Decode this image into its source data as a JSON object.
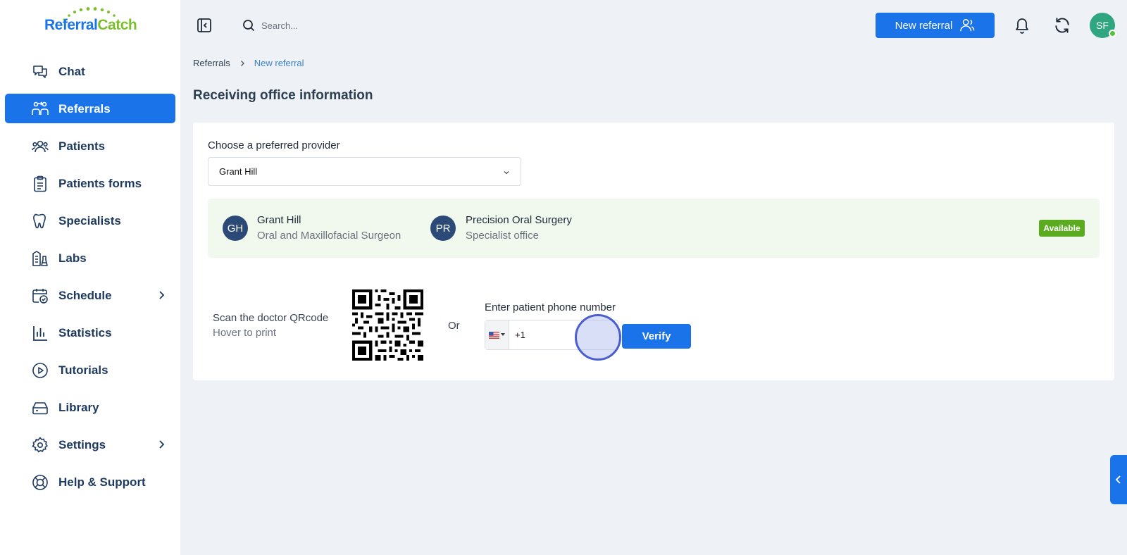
{
  "brand": {
    "logo_part1": "Referral",
    "logo_part2": "Catch",
    "primary_color": "#1a73e8",
    "accent_color": "#7bbf2a"
  },
  "sidebar": {
    "items": [
      {
        "label": "Chat",
        "icon": "chat-icon"
      },
      {
        "label": "Referrals",
        "icon": "referrals-icon",
        "active": true
      },
      {
        "label": "Patients",
        "icon": "patients-icon"
      },
      {
        "label": "Patients forms",
        "icon": "clipboard-icon"
      },
      {
        "label": "Specialists",
        "icon": "tooth-icon"
      },
      {
        "label": "Labs",
        "icon": "labs-icon"
      },
      {
        "label": "Schedule",
        "icon": "calendar-check-icon",
        "expandable": true
      },
      {
        "label": "Statistics",
        "icon": "bar-chart-icon"
      },
      {
        "label": "Tutorials",
        "icon": "play-circle-icon"
      },
      {
        "label": "Library",
        "icon": "library-icon"
      },
      {
        "label": "Settings",
        "icon": "gear-icon",
        "expandable": true
      },
      {
        "label": "Help & Support",
        "icon": "lifebuoy-icon"
      }
    ]
  },
  "header": {
    "search_placeholder": "Search...",
    "new_referral_label": "New referral",
    "avatar_initials": "SF"
  },
  "breadcrumb": {
    "root": "Referrals",
    "current": "New referral"
  },
  "page_title": "Receiving office information",
  "provider": {
    "label": "Choose a preferred provider",
    "selected": "Grant Hill"
  },
  "info": {
    "doctor_initials": "GH",
    "doctor_name": "Grant Hill",
    "doctor_role": "Oral and Maxillofacial Surgeon",
    "office_initials": "PR",
    "office_name": "Precision Oral Surgery",
    "office_type": "Specialist office",
    "status": "Available",
    "status_color": "#5aab1f"
  },
  "qr": {
    "line1": "Scan the doctor QRcode",
    "line2": "Hover to print"
  },
  "or_label": "Or",
  "phone": {
    "label": "Enter patient phone number",
    "country": "US",
    "value": "+1",
    "verify_label": "Verify"
  }
}
